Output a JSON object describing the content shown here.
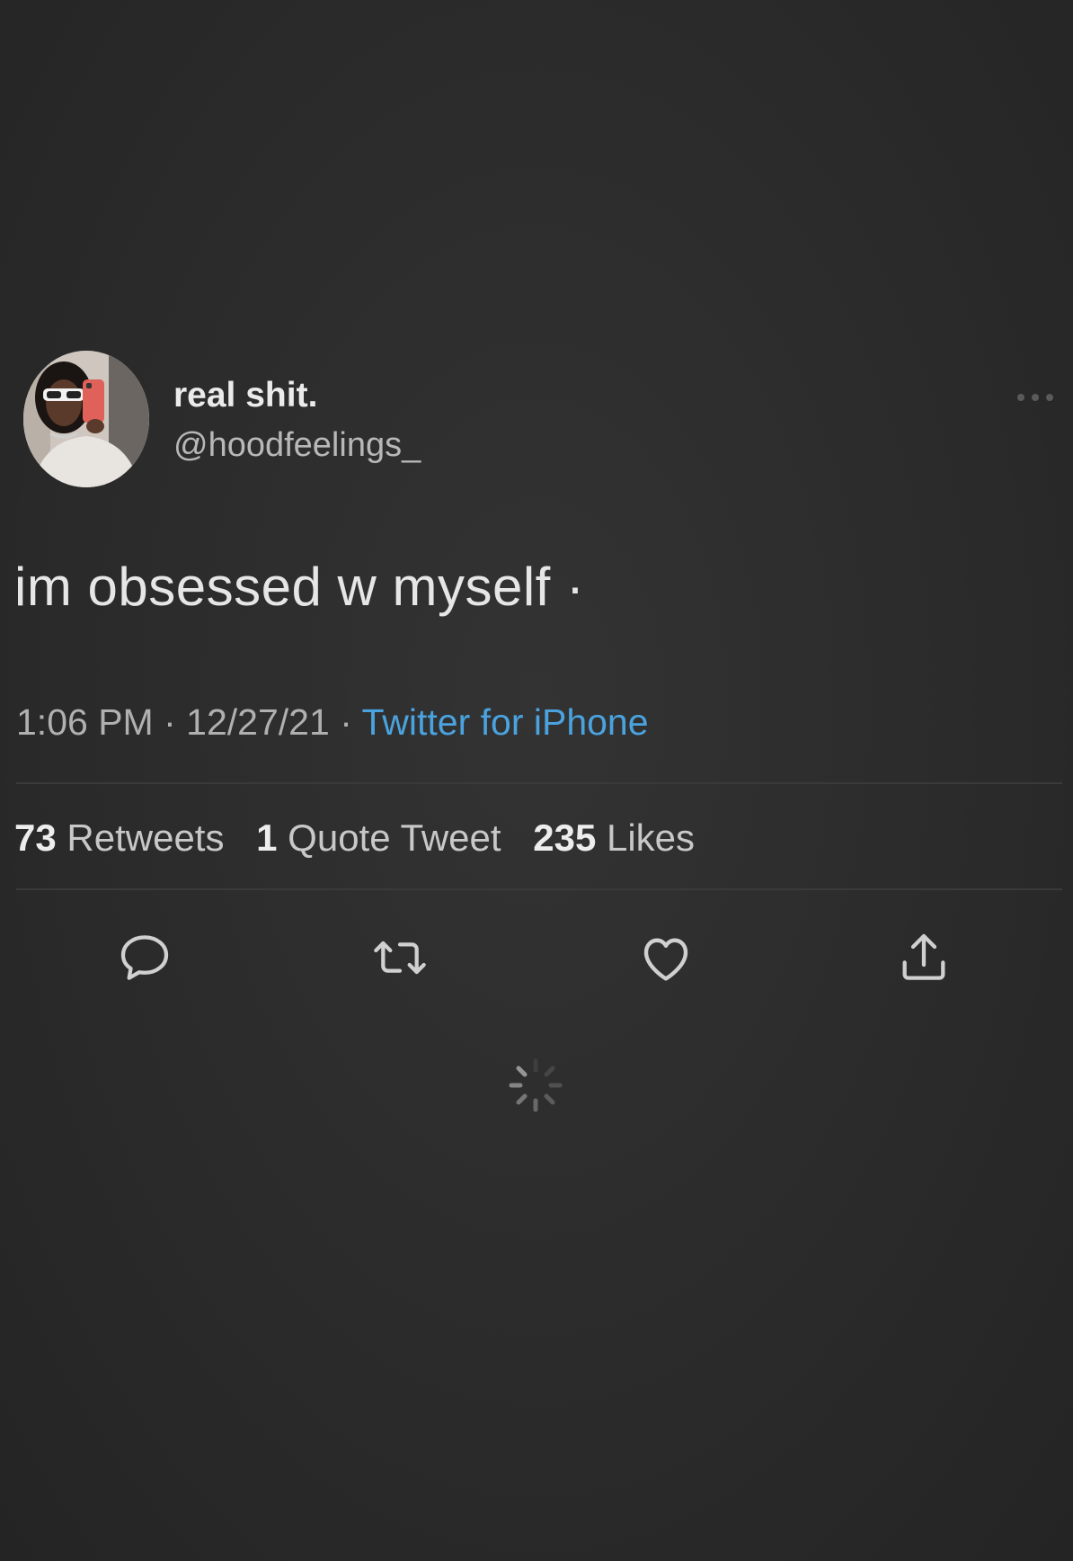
{
  "user": {
    "display_name": "real shit.",
    "handle": "@hoodfeelings_"
  },
  "tweet": {
    "text": "im obsessed w myself ·",
    "time": "1:06 PM",
    "separator": "·",
    "date": "12/27/21",
    "source": "Twitter for iPhone"
  },
  "stats": {
    "retweets_count": "73",
    "retweets_label": "Retweets",
    "quotes_count": "1",
    "quotes_label": "Quote Tweet",
    "likes_count": "235",
    "likes_label": "Likes"
  },
  "actions": [
    {
      "icon": "reply-icon"
    },
    {
      "icon": "retweet-icon"
    },
    {
      "icon": "like-icon"
    },
    {
      "icon": "share-icon"
    }
  ],
  "colors": {
    "background": "#2b2b2b",
    "link": "#4aa3df",
    "icon": "#d0d0d0"
  }
}
